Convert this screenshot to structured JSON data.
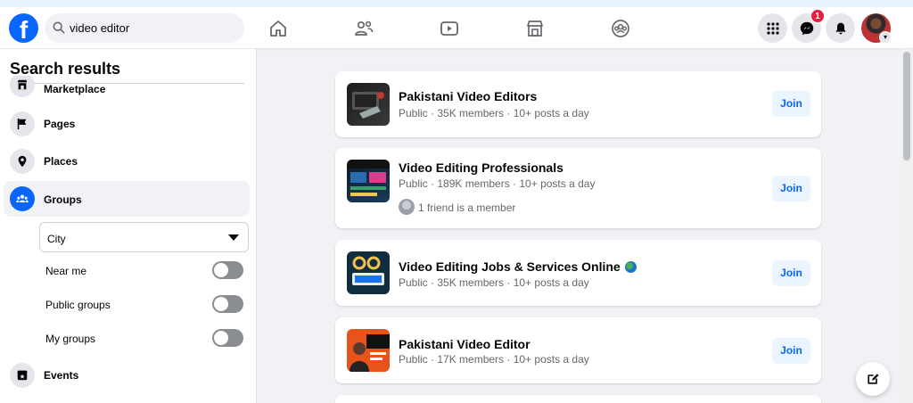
{
  "search": {
    "value": "video editor",
    "icon": "search-icon"
  },
  "header": {
    "nav_icons": [
      "home-icon",
      "friends-icon",
      "video-icon",
      "marketplace-icon",
      "groups-icon"
    ],
    "right_icons": [
      "menu-grid-icon",
      "messenger-icon",
      "notifications-icon"
    ],
    "messenger_badge": "1",
    "brand_color": "#0866ff"
  },
  "sidebar": {
    "title": "Search results",
    "items": [
      {
        "label": "Marketplace",
        "icon": "shop-icon"
      },
      {
        "label": "Pages",
        "icon": "flag-icon"
      },
      {
        "label": "Places",
        "icon": "pin-icon"
      },
      {
        "label": "Groups",
        "icon": "groups-icon"
      },
      {
        "label": "Events",
        "icon": "calendar-icon"
      }
    ],
    "city_select": "City",
    "toggles": [
      {
        "label": "Near me",
        "on": false
      },
      {
        "label": "Public groups",
        "on": false
      },
      {
        "label": "My groups",
        "on": false
      }
    ]
  },
  "results": [
    {
      "name": "Pakistani Video Editors",
      "meta": "Public · 35K members · 10+ posts a day",
      "button": "Join"
    },
    {
      "name": "Video Editing Professionals",
      "meta": "Public · 189K members · 10+ posts a day",
      "friends": "1 friend is a member",
      "button": "Join"
    },
    {
      "name": "Video Editing Jobs & Services Online",
      "meta": "Public · 35K members · 10+ posts a day",
      "button": "Join"
    },
    {
      "name": "Pakistani Video Editor",
      "meta": "Public · 17K members · 10+ posts a day",
      "button": "Join"
    }
  ]
}
